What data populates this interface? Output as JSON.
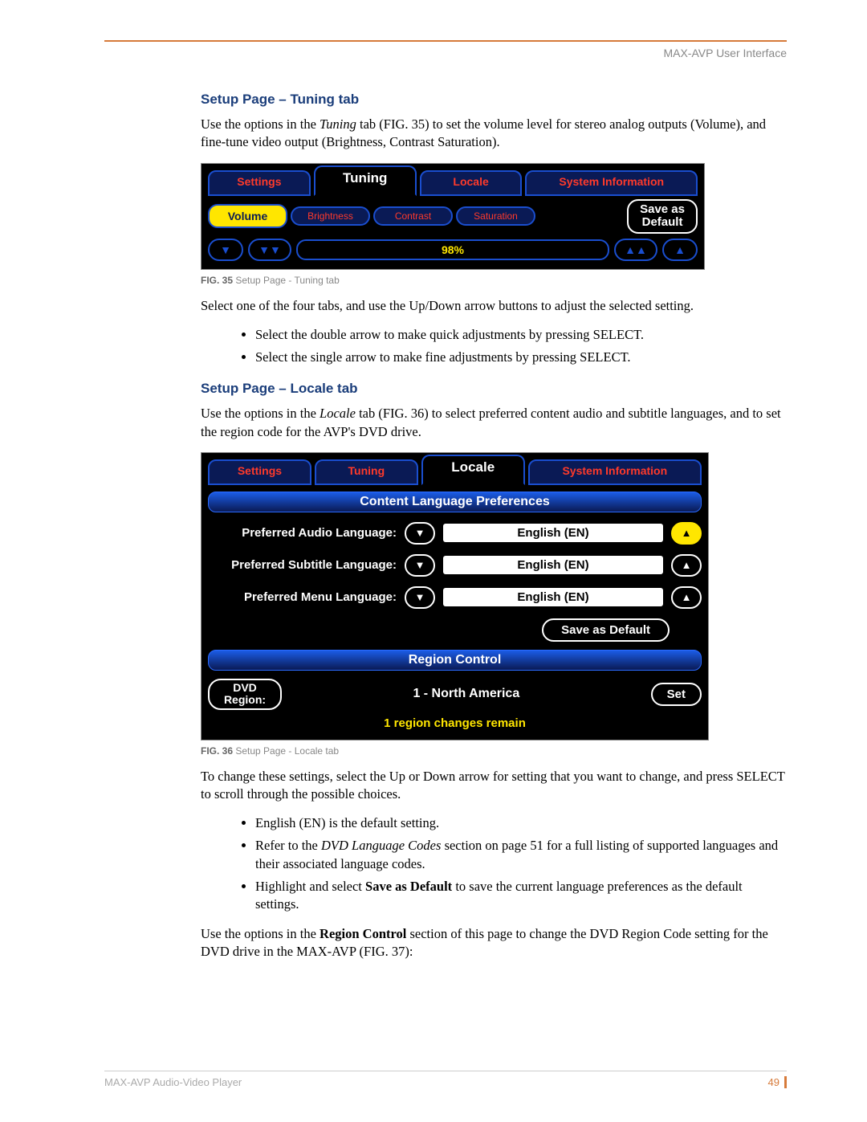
{
  "running_head": "MAX-AVP User Interface",
  "footer_text": "MAX-AVP Audio-Video Player",
  "page_number": "49",
  "sec1": {
    "heading": "Setup Page – Tuning tab",
    "p1a": "Use the options in the ",
    "p1_em": "Tuning",
    "p1b": " tab (FIG. 35) to set the volume level for stereo analog outputs (Volume), and fine-tune video output (Brightness, Contrast Saturation).",
    "fig": {
      "tabs": [
        "Settings",
        "Tuning",
        "Locale",
        "System Information"
      ],
      "subtabs": [
        "Volume",
        "Brightness",
        "Contrast",
        "Saturation"
      ],
      "save_line1": "Save as",
      "save_line2": "Default",
      "value": "98%"
    },
    "caption_b": "FIG. 35",
    "caption_t": "  Setup Page - Tuning tab",
    "p2": "Select one of the four tabs, and use the Up/Down arrow buttons to adjust the selected setting.",
    "bullets": [
      "Select the double arrow to make quick adjustments by pressing SELECT.",
      "Select the single arrow to make fine adjustments by pressing SELECT."
    ]
  },
  "sec2": {
    "heading": "Setup Page – Locale tab",
    "p1a": "Use the options in the ",
    "p1_em": "Locale",
    "p1b": " tab (FIG. 36) to select preferred content audio and subtitle languages, and to set the region code for the AVP's DVD drive.",
    "fig": {
      "tabs": [
        "Settings",
        "Tuning",
        "Locale",
        "System Information"
      ],
      "panel1": "Content Language Preferences",
      "rows": [
        {
          "label": "Preferred Audio Language:",
          "value": "English (EN)",
          "sel": true
        },
        {
          "label": "Preferred Subtitle Language:",
          "value": "English (EN)",
          "sel": false
        },
        {
          "label": "Preferred Menu Language:",
          "value": "English (EN)",
          "sel": false
        }
      ],
      "save": "Save as Default",
      "panel2": "Region Control",
      "region_label1": "DVD",
      "region_label2": "Region:",
      "region_value": "1 - North America",
      "set": "Set",
      "warn": "1 region changes remain"
    },
    "caption_b": "FIG. 36",
    "caption_t": "  Setup Page - Locale tab",
    "p2": "To change these settings, select the Up or Down arrow for setting that you want to change, and press SELECT to scroll through the possible choices.",
    "b1": "English (EN) is the default setting.",
    "b2a": "Refer to the ",
    "b2_em": "DVD Language Codes",
    "b2b": " section on page 51 for a full listing of supported languages and their associated language codes.",
    "b3a": "Highlight and select ",
    "b3_strong": "Save as Default",
    "b3b": " to save the current language preferences as the default settings.",
    "p3a": "Use the options in the ",
    "p3_strong": "Region Control",
    "p3b": " section of this page to change the DVD Region Code setting for the DVD drive in the MAX-AVP (FIG. 37):"
  }
}
